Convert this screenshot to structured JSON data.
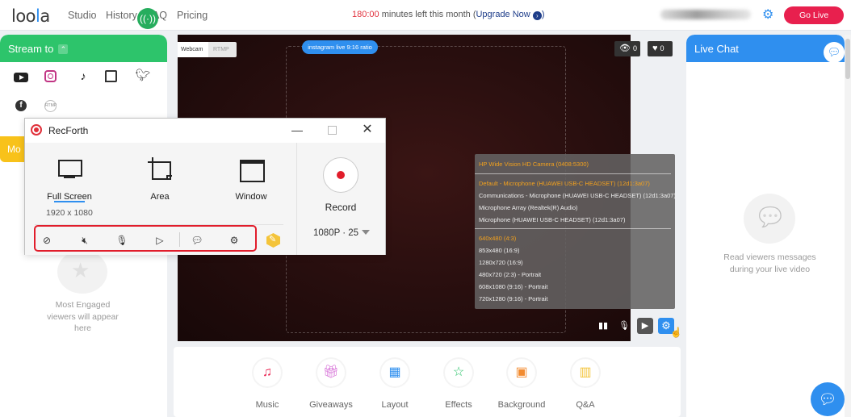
{
  "nav": {
    "logo_text": "loola",
    "links": [
      "Studio",
      "History",
      "FAQ",
      "Pricing"
    ],
    "minutes_value": "180:00",
    "minutes_suffix": " minutes left this month (",
    "upgrade_label": "Upgrade Now",
    "go_live": "Go Live"
  },
  "left": {
    "stream_to": "Stream to",
    "platforms": [
      "youtube",
      "instagram",
      "tiktok",
      "twitch",
      "twitter",
      "facebook",
      "rtmp"
    ],
    "moderate_tab": "Mo",
    "engaged_text": "Most Engaged viewers will appear here"
  },
  "video": {
    "tab_webcam": "Webcam",
    "tab_rtmp": "RTMP",
    "ratio_label": "instagram live 9:16 ratio",
    "views": "0",
    "likes": "0",
    "devices": {
      "camera": "HP Wide Vision HD Camera (0408:5300)",
      "audio": [
        "Default - Microphone (HUAWEI USB-C HEADSET) (12d1:3a07)",
        "Communications - Microphone (HUAWEI USB-C HEADSET) (12d1:3a07)",
        "Microphone Array (Realtek(R) Audio)",
        "Microphone (HUAWEI USB-C HEADSET) (12d1:3a07)"
      ],
      "resolutions": [
        "640x480 (4:3)",
        "853x480 (16:9)",
        "1280x720 (16:9)",
        "480x720 (2:3) - Portrait",
        "608x1080 (9:16) - Portrait",
        "720x1280 (9:16) - Portrait"
      ]
    }
  },
  "tools": [
    "Music",
    "Giveaways",
    "Layout",
    "Effects",
    "Background",
    "Q&A"
  ],
  "chat": {
    "title": "Live Chat",
    "empty_text": "Read viewers messages during your live video"
  },
  "recforth": {
    "title": "RecForth",
    "modes": [
      "Full Screen",
      "Area",
      "Window"
    ],
    "resolution": "1920 x 1080",
    "record_label": "Record",
    "quality": "1080P · 25"
  },
  "colors": {
    "green": "#2dc46b",
    "blue": "#2f8fef",
    "red": "#e8204e",
    "yellow": "#f8c21a",
    "highlight_box": "#e11d2b"
  }
}
